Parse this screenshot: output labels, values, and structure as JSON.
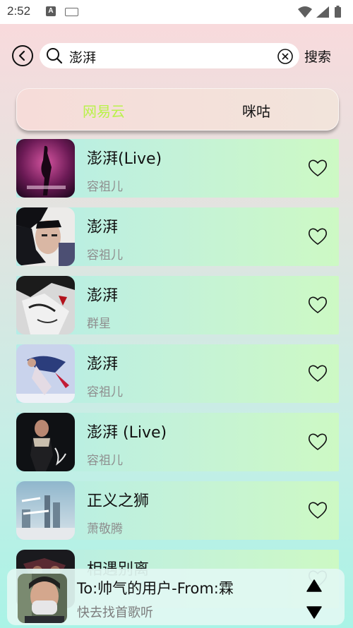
{
  "status_bar": {
    "time": "2:52",
    "a_icon": "A"
  },
  "header": {
    "search_value": "澎湃",
    "search_button": "搜索"
  },
  "tabs": [
    {
      "label": "网易云",
      "active": true,
      "color": "#b9f24a"
    },
    {
      "label": "咪咕",
      "active": false
    }
  ],
  "songs": [
    {
      "title": "澎湃(Live)",
      "artist": "容祖儿"
    },
    {
      "title": "澎湃",
      "artist": "容祖儿"
    },
    {
      "title": "澎湃",
      "artist": "群星"
    },
    {
      "title": "澎湃",
      "artist": "容祖儿"
    },
    {
      "title": "澎湃 (Live)",
      "artist": "容祖儿"
    },
    {
      "title": "正义之狮",
      "artist": "萧敬腾"
    },
    {
      "title": "相遇别离",
      "artist": ""
    }
  ],
  "player": {
    "title": "To:帅气的用户-From:霖",
    "subtitle": "快去找首歌听"
  }
}
